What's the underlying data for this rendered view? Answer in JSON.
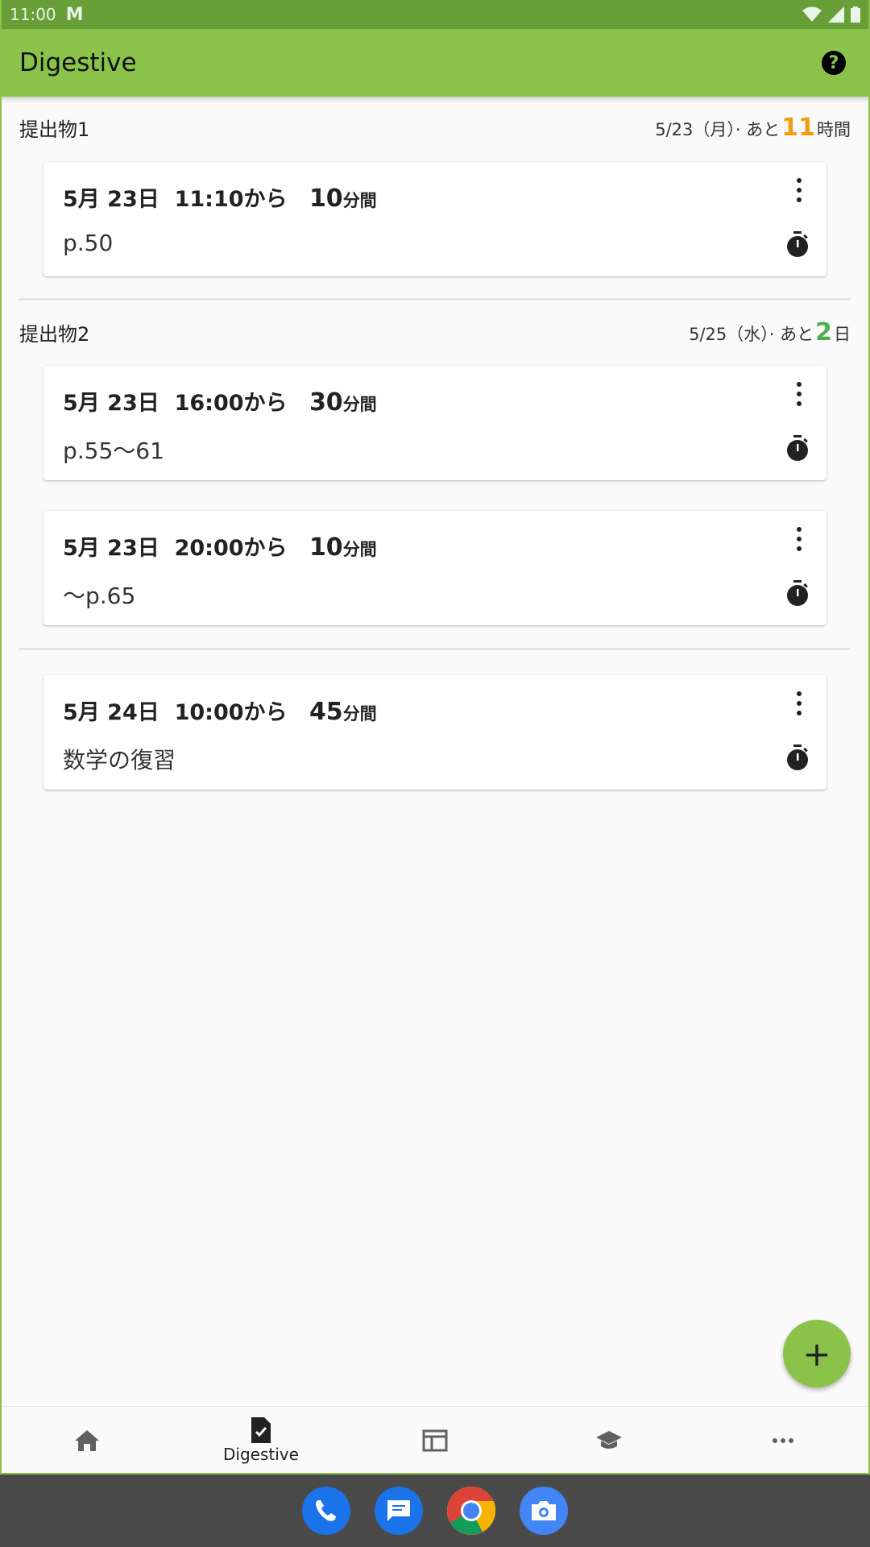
{
  "status_bar": {
    "time": "11:00",
    "notification": "M"
  },
  "app_bar": {
    "title": "Digestive",
    "help_label": "?"
  },
  "groups": [
    {
      "name": "提出物1",
      "due_date": "5/23（月）· あと",
      "remaining_value": "11",
      "remaining_unit": "時間",
      "remaining_color": "#f39c12",
      "tasks": [
        {
          "date": "5月 23日",
          "time": "11:10から",
          "duration": "10",
          "duration_unit": "分間",
          "note": "p.50"
        }
      ]
    },
    {
      "name": "提出物2",
      "due_date": "5/25（水）· あと",
      "remaining_value": "2",
      "remaining_unit": "日",
      "remaining_color": "#4caf50",
      "tasks": [
        {
          "date": "5月 23日",
          "time": "16:00から",
          "duration": "30",
          "duration_unit": "分間",
          "note": "p.55〜61"
        },
        {
          "date": "5月 23日",
          "time": "20:00から",
          "duration": "10",
          "duration_unit": "分間",
          "note": "〜p.65"
        }
      ]
    },
    {
      "name": "",
      "tasks": [
        {
          "date": "5月 24日",
          "time": "10:00から",
          "duration": "45",
          "duration_unit": "分間",
          "note": "数学の復習"
        }
      ]
    }
  ],
  "fab": {
    "label": "+"
  },
  "bottom_nav": [
    {
      "icon": "home-icon",
      "label": ""
    },
    {
      "icon": "assignment-check-icon",
      "label": "Digestive"
    },
    {
      "icon": "timetable-icon",
      "label": ""
    },
    {
      "icon": "school-icon",
      "label": ""
    },
    {
      "icon": "more-horizontal-icon",
      "label": ""
    }
  ],
  "dock_apps": [
    {
      "icon": "phone-icon",
      "color": "#1a73e8"
    },
    {
      "icon": "messages-icon",
      "color": "#1a73e8"
    },
    {
      "icon": "chrome-icon",
      "color": "#ffffff"
    },
    {
      "icon": "camera-icon",
      "color": "#4285f4"
    }
  ],
  "colors": {
    "primary": "#8bc34a",
    "primary_dark": "#689f38"
  }
}
